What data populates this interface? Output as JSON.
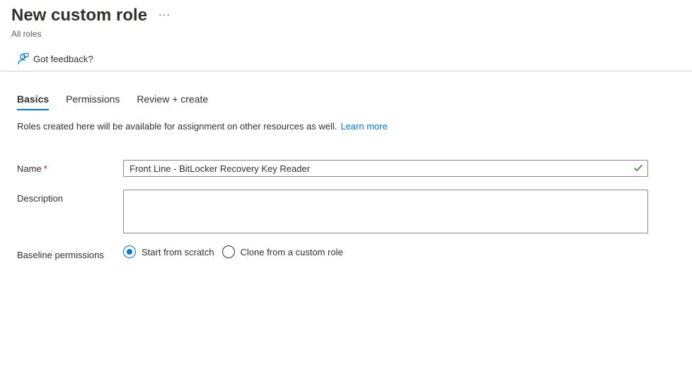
{
  "header": {
    "title": "New custom role",
    "more_label": "···",
    "breadcrumb": "All roles"
  },
  "toolbar": {
    "feedback_label": "Got feedback?"
  },
  "tabs": [
    {
      "label": "Basics",
      "active": true
    },
    {
      "label": "Permissions",
      "active": false
    },
    {
      "label": "Review + create",
      "active": false
    }
  ],
  "intro": {
    "text": "Roles created here will be available for assignment on other resources as well.",
    "link": "Learn more"
  },
  "form": {
    "name_label": "Name",
    "required_marker": "*",
    "name_value": "Front Line - BitLocker Recovery Key Reader",
    "description_label": "Description",
    "description_value": "",
    "baseline_label": "Baseline permissions",
    "baseline_options": [
      {
        "label": "Start from scratch",
        "selected": true
      },
      {
        "label": "Clone from a custom role",
        "selected": false
      }
    ]
  },
  "colors": {
    "accent": "#0078d4",
    "valid": "#107c10",
    "required": "#a4262c"
  }
}
